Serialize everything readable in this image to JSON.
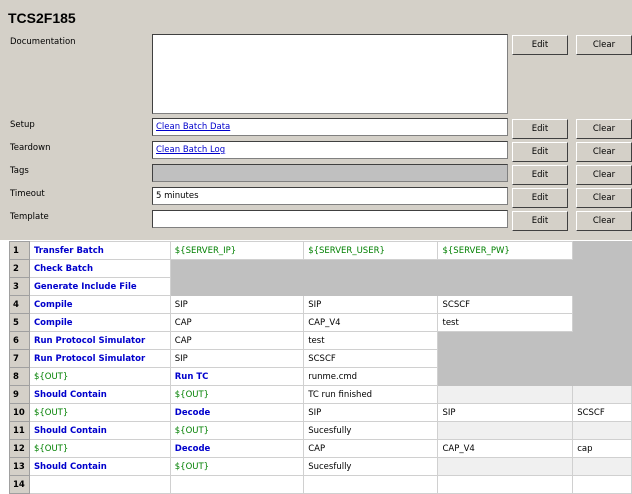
{
  "title": "TCS2F185",
  "settings": {
    "documentation": {
      "label": "Documentation",
      "value": ""
    },
    "setup": {
      "label": "Setup",
      "value": "Clean Batch Data"
    },
    "teardown": {
      "label": "Teardown",
      "value": "Clean Batch Log"
    },
    "tags": {
      "label": "Tags",
      "value": ""
    },
    "timeout": {
      "label": "Timeout",
      "value": "5 minutes"
    },
    "template": {
      "label": "Template",
      "value": ""
    }
  },
  "buttons": {
    "edit": "Edit",
    "clear": "Clear"
  },
  "rows": [
    {
      "num": "1",
      "cells": [
        "Transfer Batch",
        "${SERVER_IP}",
        "${SERVER_USER}",
        "${SERVER_PW}",
        ""
      ]
    },
    {
      "num": "2",
      "cells": [
        "Check Batch",
        "",
        "",
        "",
        ""
      ]
    },
    {
      "num": "3",
      "cells": [
        "Generate Include File",
        "",
        "",
        "",
        ""
      ]
    },
    {
      "num": "4",
      "cells": [
        "Compile",
        "SIP",
        "SIP",
        "SCSCF",
        ""
      ]
    },
    {
      "num": "5",
      "cells": [
        "Compile",
        "CAP",
        "CAP_V4",
        "test",
        ""
      ]
    },
    {
      "num": "6",
      "cells": [
        "Run Protocol Simulator",
        "CAP",
        "test",
        "",
        ""
      ]
    },
    {
      "num": "7",
      "cells": [
        "Run Protocol Simulator",
        "SIP",
        "SCSCF",
        "",
        ""
      ]
    },
    {
      "num": "8",
      "cells": [
        "${OUT}",
        "Run TC",
        "runme.cmd",
        "",
        ""
      ]
    },
    {
      "num": "9",
      "cells": [
        "Should Contain",
        "${OUT}",
        "TC run finished",
        "",
        ""
      ]
    },
    {
      "num": "10",
      "cells": [
        "${OUT}",
        "Decode",
        "SIP",
        "SIP",
        "SCSCF"
      ]
    },
    {
      "num": "11",
      "cells": [
        "Should Contain",
        "${OUT}",
        "Sucesfully",
        "",
        ""
      ]
    },
    {
      "num": "12",
      "cells": [
        "${OUT}",
        "Decode",
        "CAP",
        "CAP_V4",
        "cap"
      ]
    },
    {
      "num": "13",
      "cells": [
        "Should Contain",
        "${OUT}",
        "Sucesfully",
        "",
        ""
      ]
    },
    {
      "num": "14",
      "cells": [
        "",
        "",
        "",
        "",
        ""
      ]
    }
  ]
}
